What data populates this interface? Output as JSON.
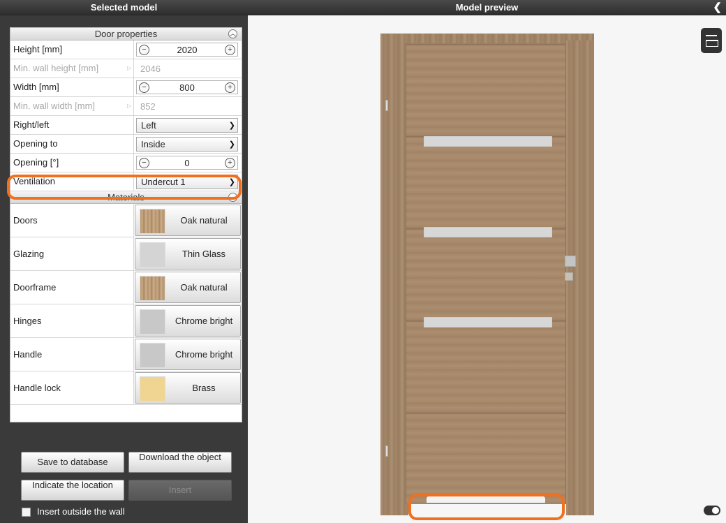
{
  "left_panel": {
    "title": "Selected model",
    "door_properties": {
      "header": "Door properties",
      "rows": [
        {
          "label": "Height [mm]",
          "type": "spinner",
          "value": "2020"
        },
        {
          "label": "Min. wall height [mm]",
          "type": "readonly",
          "value": "2046"
        },
        {
          "label": "Width [mm]",
          "type": "spinner",
          "value": "800"
        },
        {
          "label": "Min. wall width [mm]",
          "type": "readonly",
          "value": "852"
        },
        {
          "label": "Right/left",
          "type": "select",
          "value": "Left"
        },
        {
          "label": "Opening to",
          "type": "select",
          "value": "Inside"
        },
        {
          "label": "Opening [°]",
          "type": "spinner",
          "value": "0"
        },
        {
          "label": "Ventilation",
          "type": "select",
          "value": "Undercut 1"
        }
      ]
    },
    "materials": {
      "header": "Materials",
      "rows": [
        {
          "label": "Doors",
          "material": "Oak natural",
          "swatch": "oak"
        },
        {
          "label": "Glazing",
          "material": "Thin Glass",
          "swatch": "glass"
        },
        {
          "label": "Doorframe",
          "material": "Oak natural",
          "swatch": "oak"
        },
        {
          "label": "Hinges",
          "material": "Chrome bright",
          "swatch": "chrome"
        },
        {
          "label": "Handle",
          "material": "Chrome bright",
          "swatch": "chrome"
        },
        {
          "label": "Handle lock",
          "material": "Brass",
          "swatch": "brass"
        }
      ]
    },
    "buttons": {
      "save": "Save to database",
      "download": "Download the object",
      "indicate": "Indicate the location",
      "insert": "Insert"
    },
    "checkbox_label": "Insert outside the wall"
  },
  "right_panel": {
    "title": "Model preview",
    "icons": [
      "back-chevron-icon",
      "dimensions-icon",
      "toggle-icon"
    ]
  },
  "colors": {
    "highlight": "#f07020",
    "panel_bg": "#3a3a3a",
    "preview_bg": "#f6f6f6",
    "wood": "#a8896a"
  }
}
